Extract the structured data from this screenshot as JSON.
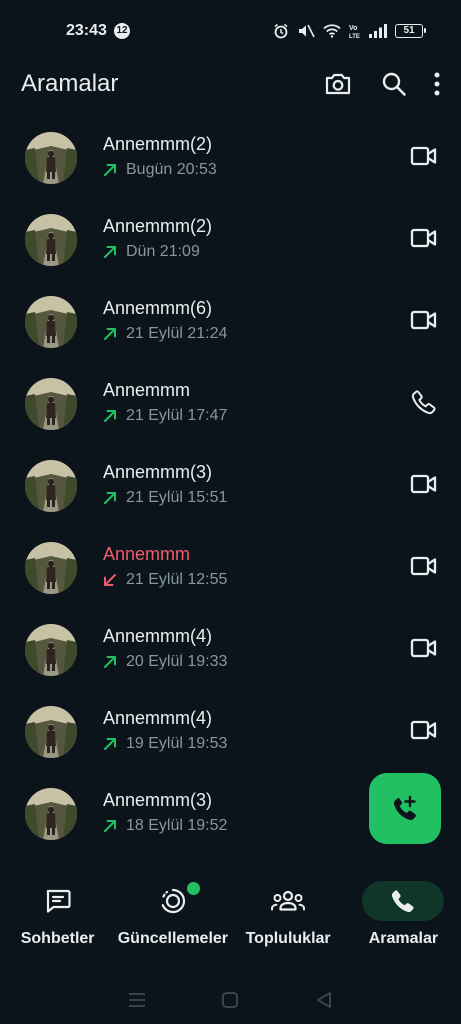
{
  "status_bar": {
    "time": "23:43",
    "notification_count": "12",
    "battery": "51",
    "icons": [
      "alarm-icon",
      "mute-icon",
      "wifi-icon",
      "volte-icon",
      "signal-icon",
      "battery-icon"
    ]
  },
  "app_bar": {
    "title": "Aramalar",
    "actions": [
      "camera-icon",
      "search-icon",
      "more-vert-icon"
    ]
  },
  "calls": [
    {
      "name": "Annemmm(2)",
      "time": "Bugün 20:53",
      "direction": "outgoing",
      "type": "video",
      "missed": false
    },
    {
      "name": "Annemmm(2)",
      "time": "Dün 21:09",
      "direction": "outgoing",
      "type": "video",
      "missed": false
    },
    {
      "name": "Annemmm(6)",
      "time": "21 Eylül 21:24",
      "direction": "outgoing",
      "type": "video",
      "missed": false
    },
    {
      "name": "Annemmm",
      "time": "21 Eylül 17:47",
      "direction": "outgoing",
      "type": "voice",
      "missed": false
    },
    {
      "name": "Annemmm(3)",
      "time": "21 Eylül 15:51",
      "direction": "outgoing",
      "type": "video",
      "missed": false
    },
    {
      "name": "Annemmm",
      "time": "21 Eylül 12:55",
      "direction": "incoming",
      "type": "video",
      "missed": true
    },
    {
      "name": "Annemmm(4)",
      "time": "20 Eylül 19:33",
      "direction": "outgoing",
      "type": "video",
      "missed": false
    },
    {
      "name": "Annemmm(4)",
      "time": "19 Eylül 19:53",
      "direction": "outgoing",
      "type": "video",
      "missed": false
    },
    {
      "name": "Annemmm(3)",
      "time": "18 Eylül 19:52",
      "direction": "outgoing",
      "type": "video",
      "missed": false
    }
  ],
  "fab": {
    "icon": "add-call-icon"
  },
  "bottom_nav": [
    {
      "label": "Sohbetler",
      "icon": "chats-icon",
      "active": false
    },
    {
      "label": "Güncellemeler",
      "icon": "updates-icon",
      "active": false,
      "dot": true
    },
    {
      "label": "Topluluklar",
      "icon": "communities-icon",
      "active": false
    },
    {
      "label": "Aramalar",
      "icon": "calls-icon",
      "active": true
    }
  ],
  "colors": {
    "background": "#0b141a",
    "text": "#e9edef",
    "secondary_text": "#8696a0",
    "accent": "#21c063",
    "missed": "#f15c6d",
    "nav_active_bg": "#103529"
  }
}
